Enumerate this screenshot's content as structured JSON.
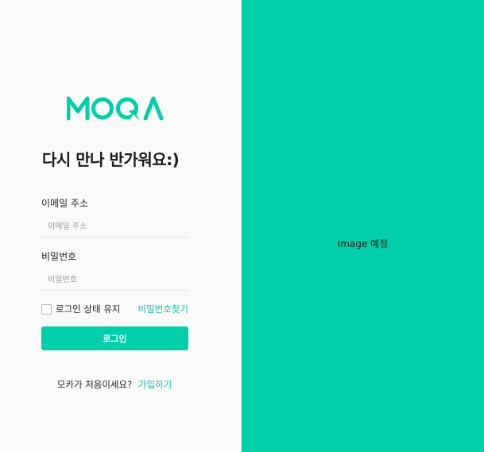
{
  "brand": {
    "logo_text": "MOQA",
    "accent_color": "#00cfaa",
    "link_color": "#13c2a0"
  },
  "login": {
    "greeting": "다시 만나 반가워요:)",
    "email_label": "이메일 주소",
    "email_placeholder": "이메일 주소",
    "password_label": "비밀번호",
    "password_placeholder": "비밀번호",
    "remember_label": "로그인 상태 유지",
    "remember_checked": false,
    "find_password": "비밀번호찾기",
    "login_button": "로그인",
    "signup_prompt": "모카가 처음이세요?",
    "signup_link": "가입하기"
  },
  "hero": {
    "placeholder_text": "image 예정"
  }
}
